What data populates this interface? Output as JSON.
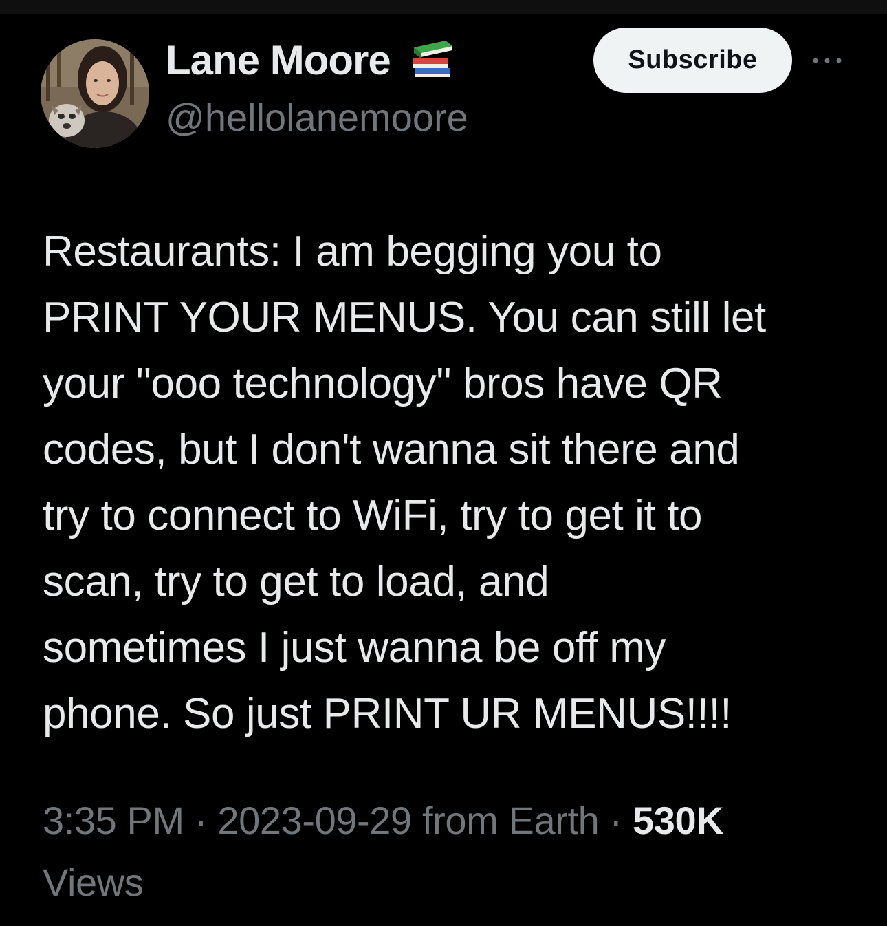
{
  "author": {
    "display_name": "Lane Moore",
    "badge_icon": "books-emoji-icon",
    "handle": "@hellolanemoore"
  },
  "actions": {
    "subscribe_label": "Subscribe",
    "more_icon": "more-horizontal-icon"
  },
  "tweet": {
    "lines": [
      "Restaurants: I am begging you to",
      "PRINT YOUR MENUS. You can still let",
      "your \"ooo technology\" bros have QR",
      "codes, but I don't wanna sit there and",
      "try to connect to WiFi, try to get it to",
      "scan, try to get to load, and",
      "sometimes I just wanna be off my",
      "phone. So just PRINT UR MENUS!!!!"
    ]
  },
  "meta": {
    "time": "3:35 PM",
    "separator": " · ",
    "date": "2023-09-29",
    "source": " from Earth",
    "views_count": "530K",
    "views_label": "Views"
  },
  "colors": {
    "background": "#000000",
    "primary_text": "#e7e9ea",
    "secondary_text": "#71767b",
    "button_bg": "#eff3f4"
  }
}
